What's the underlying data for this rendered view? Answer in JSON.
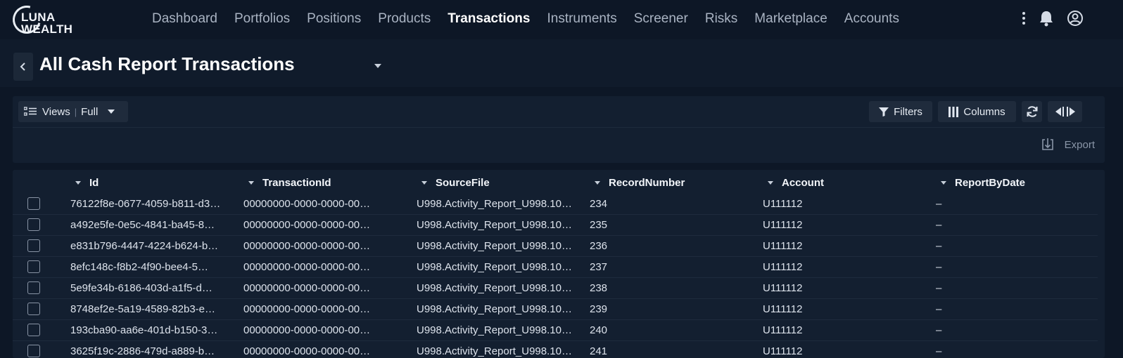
{
  "brand": {
    "line1": "LUNA",
    "line2": "WEALTH"
  },
  "nav": [
    {
      "label": "Dashboard",
      "active": false
    },
    {
      "label": "Portfolios",
      "active": false
    },
    {
      "label": "Positions",
      "active": false
    },
    {
      "label": "Products",
      "active": false
    },
    {
      "label": "Transactions",
      "active": true
    },
    {
      "label": "Instruments",
      "active": false
    },
    {
      "label": "Screener",
      "active": false
    },
    {
      "label": "Risks",
      "active": false
    },
    {
      "label": "Marketplace",
      "active": false
    },
    {
      "label": "Accounts",
      "active": false
    }
  ],
  "page": {
    "title": "All Cash Report Transactions"
  },
  "toolbar": {
    "views_label": "Views",
    "views_value": "Full",
    "filters_label": "Filters",
    "columns_label": "Columns",
    "export_label": "Export"
  },
  "table": {
    "columns": [
      "Id",
      "TransactionId",
      "SourceFile",
      "RecordNumber",
      "Account",
      "ReportByDate"
    ],
    "rows": [
      [
        "76122f8e-0677-4059-b811-d3…",
        "00000000-0000-0000-00…",
        "U998.Activity_Report_U998.10…",
        "234",
        "U111112",
        "–"
      ],
      [
        "a492e5fe-0e5c-4841-ba45-8…",
        "00000000-0000-0000-00…",
        "U998.Activity_Report_U998.10…",
        "235",
        "U111112",
        "–"
      ],
      [
        "e831b796-4447-4224-b624-b…",
        "00000000-0000-0000-00…",
        "U998.Activity_Report_U998.10…",
        "236",
        "U111112",
        "–"
      ],
      [
        "8efc148c-f8b2-4f90-bee4-5…",
        "00000000-0000-0000-00…",
        "U998.Activity_Report_U998.10…",
        "237",
        "U111112",
        "–"
      ],
      [
        "5e9fe34b-6186-403d-a1f5-d…",
        "00000000-0000-0000-00…",
        "U998.Activity_Report_U998.10…",
        "238",
        "U111112",
        "–"
      ],
      [
        "8748ef2e-5a19-4589-82b3-e…",
        "00000000-0000-0000-00…",
        "U998.Activity_Report_U998.10…",
        "239",
        "U111112",
        "–"
      ],
      [
        "193cba90-aa6e-401d-b150-3…",
        "00000000-0000-0000-00…",
        "U998.Activity_Report_U998.10…",
        "240",
        "U111112",
        "–"
      ],
      [
        "3625f19c-2886-479d-a889-b…",
        "00000000-0000-0000-00…",
        "U998.Activity_Report_U998.10…",
        "241",
        "U111112",
        "–"
      ]
    ]
  },
  "icons": {
    "more": "more-vertical-icon",
    "notifications": "bell-icon",
    "profile": "user-circle-icon",
    "back": "chevron-left-icon",
    "title_dropdown": "caret-down-icon",
    "views": "list-icon",
    "filters": "filter-icon",
    "columns": "columns-icon",
    "refresh": "refresh-icon",
    "panels": "split-arrows-icon",
    "export": "export-icon"
  }
}
